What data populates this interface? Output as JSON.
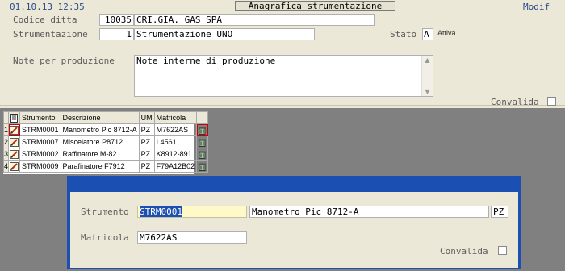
{
  "header": {
    "datetime": "01.10.13 12:35",
    "title": "Anagrafica strumentazione",
    "mode": "Modif"
  },
  "form": {
    "codice_ditta_label": "Codice ditta",
    "codice_ditta_value": "10035",
    "company_name": "CRI.GIA. GAS SPA",
    "strumentazione_label": "Strumentazione",
    "strumentazione_value": "1",
    "strumentazione_desc": "Strumentazione UNO",
    "stato_label": "Stato",
    "stato_value": "A",
    "stato_desc": "Attiva",
    "note_label": "Note per produzione",
    "note_value": "Note interne di produzione",
    "convalida_label": "Convalida"
  },
  "grid": {
    "columns": [
      "Strumento",
      "Descrizione",
      "UM",
      "Matricola"
    ],
    "rows": [
      {
        "n": "1",
        "strumento": "STRM0001",
        "descrizione": "Manometro Pic 8712-A",
        "um": "PZ",
        "matricola": "M7622AS"
      },
      {
        "n": "2",
        "strumento": "STRM0007",
        "descrizione": "Miscelatore P8712",
        "um": "PZ",
        "matricola": "L4561"
      },
      {
        "n": "3",
        "strumento": "STRM0002",
        "descrizione": "Raffinatore M-82",
        "um": "PZ",
        "matricola": "K8912-891"
      },
      {
        "n": "4",
        "strumento": "STRM0009",
        "descrizione": "Parafinatore F7912",
        "um": "PZ",
        "matricola": "F79A12B02"
      }
    ]
  },
  "dialog": {
    "strumento_label": "Strumento",
    "strumento_code": "STRM0001",
    "strumento_desc": "Manometro Pic 8712-A",
    "strumento_um": "PZ",
    "matricola_label": "Matricola",
    "matricola_value": "M7622AS",
    "convalida_label": "Convalida"
  },
  "colors": {
    "panel_bg": "#ece8d8",
    "dialog_titlebar": "#1c4fb2",
    "selection": "#1c4fb2",
    "label": "#5a5a5a",
    "workspace": "#808080"
  },
  "icons": {
    "edit": "edit-pencil-icon",
    "delete": "trash-icon",
    "new_row": "new-document-icon"
  }
}
